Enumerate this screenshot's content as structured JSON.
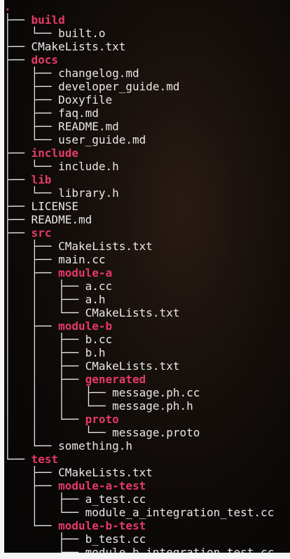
{
  "terminal": {
    "root": ".",
    "colors": {
      "directory": "#e43a67",
      "file": "#e8e8e8",
      "background": "#0b0807"
    },
    "lines": [
      {
        "prefix": "├── ",
        "name": "build",
        "type": "dir"
      },
      {
        "prefix": "│   └── ",
        "name": "built.o",
        "type": "file"
      },
      {
        "prefix": "├── ",
        "name": "CMakeLists.txt",
        "type": "file"
      },
      {
        "prefix": "├── ",
        "name": "docs",
        "type": "dir"
      },
      {
        "prefix": "│   ├── ",
        "name": "changelog.md",
        "type": "file"
      },
      {
        "prefix": "│   ├── ",
        "name": "developer_guide.md",
        "type": "file"
      },
      {
        "prefix": "│   ├── ",
        "name": "Doxyfile",
        "type": "file"
      },
      {
        "prefix": "│   ├── ",
        "name": "faq.md",
        "type": "file"
      },
      {
        "prefix": "│   ├── ",
        "name": "README.md",
        "type": "file"
      },
      {
        "prefix": "│   └── ",
        "name": "user_guide.md",
        "type": "file"
      },
      {
        "prefix": "├── ",
        "name": "include",
        "type": "dir"
      },
      {
        "prefix": "│   └── ",
        "name": "include.h",
        "type": "file"
      },
      {
        "prefix": "├── ",
        "name": "lib",
        "type": "dir"
      },
      {
        "prefix": "│   └── ",
        "name": "library.h",
        "type": "file"
      },
      {
        "prefix": "├── ",
        "name": "LICENSE",
        "type": "file"
      },
      {
        "prefix": "├── ",
        "name": "README.md",
        "type": "file"
      },
      {
        "prefix": "├── ",
        "name": "src",
        "type": "dir"
      },
      {
        "prefix": "│   ├── ",
        "name": "CMakeLists.txt",
        "type": "file"
      },
      {
        "prefix": "│   ├── ",
        "name": "main.cc",
        "type": "file"
      },
      {
        "prefix": "│   ├── ",
        "name": "module-a",
        "type": "dir"
      },
      {
        "prefix": "│   │   ├── ",
        "name": "a.cc",
        "type": "file"
      },
      {
        "prefix": "│   │   ├── ",
        "name": "a.h",
        "type": "file"
      },
      {
        "prefix": "│   │   └── ",
        "name": "CMakeLists.txt",
        "type": "file"
      },
      {
        "prefix": "│   ├── ",
        "name": "module-b",
        "type": "dir"
      },
      {
        "prefix": "│   │   ├── ",
        "name": "b.cc",
        "type": "file"
      },
      {
        "prefix": "│   │   ├── ",
        "name": "b.h",
        "type": "file"
      },
      {
        "prefix": "│   │   ├── ",
        "name": "CMakeLists.txt",
        "type": "file"
      },
      {
        "prefix": "│   │   ├── ",
        "name": "generated",
        "type": "dir"
      },
      {
        "prefix": "│   │   │   ├── ",
        "name": "message.ph.cc",
        "type": "file"
      },
      {
        "prefix": "│   │   │   └── ",
        "name": "message.ph.h",
        "type": "file"
      },
      {
        "prefix": "│   │   └── ",
        "name": "proto",
        "type": "dir"
      },
      {
        "prefix": "│   │       └── ",
        "name": "message.proto",
        "type": "file"
      },
      {
        "prefix": "│   └── ",
        "name": "something.h",
        "type": "file"
      },
      {
        "prefix": "└── ",
        "name": "test",
        "type": "dir"
      },
      {
        "prefix": "    ├── ",
        "name": "CMakeLists.txt",
        "type": "file"
      },
      {
        "prefix": "    ├── ",
        "name": "module-a-test",
        "type": "dir"
      },
      {
        "prefix": "    │   ├── ",
        "name": "a_test.cc",
        "type": "file"
      },
      {
        "prefix": "    │   └── ",
        "name": "module_a_integration_test.cc",
        "type": "file"
      },
      {
        "prefix": "    └── ",
        "name": "module-b-test",
        "type": "dir"
      },
      {
        "prefix": "        ├── ",
        "name": "b_test.cc",
        "type": "file"
      },
      {
        "prefix": "        └── ",
        "name": "module_b_integration_test.cc",
        "type": "file"
      }
    ]
  }
}
